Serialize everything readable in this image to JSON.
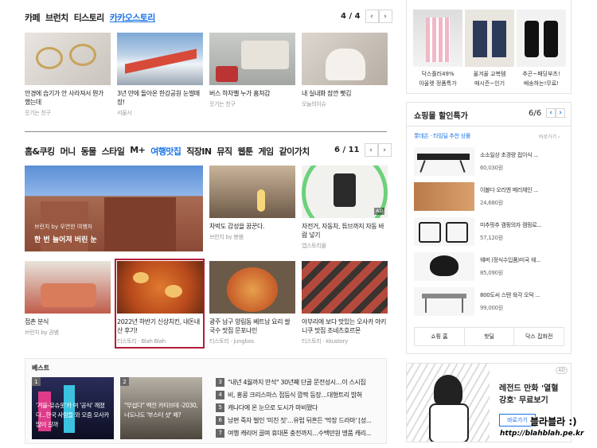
{
  "top": {
    "tabs": [
      "카페",
      "브런치",
      "티스토리",
      "카카오스토리"
    ],
    "page": "4 / 4",
    "cards": [
      {
        "caption": "안경에 습기가 안 사라져서 뭔가 했는데",
        "source": "웃기는 친구"
      },
      {
        "caption": "3년 만에 돌아온 한강공원 눈썰매장!",
        "source": "서울시"
      },
      {
        "caption": "버스 하차벨 누가 훔쳐감",
        "source": "웃기는 친구"
      },
      {
        "caption": "내 실내화 잠깐 빳김",
        "source": "오늘의이슈"
      }
    ]
  },
  "mid": {
    "tabs": [
      "홈&쿠킹",
      "머니",
      "동물",
      "스타일",
      "M+",
      "여행맛집",
      "직장IN",
      "뮤직",
      "웹툰",
      "게임",
      "같이가치"
    ],
    "page": "6 / 11",
    "hero": {
      "line1": "브런치 by 우연한 여행자",
      "line2": "한 번 늘어져 버린 눈"
    },
    "cards": [
      {
        "caption": "차박도 감성을 꿈꾼다.",
        "source": "브런치 by 봉쌤"
      },
      {
        "caption": "자전거, 자동차, 튜브까지 자동 바람 넣기",
        "source": "앱스토리몰",
        "badge": "AD"
      },
      {
        "caption": "접촌 분식",
        "source": "브런치 by 권쌤"
      },
      {
        "caption": "2022년 하반기 신상치킨, 내돈내산 후기!",
        "source": "티스토리 · Blah Blah"
      },
      {
        "caption": "광주 남구 양림동 베트남 요리 쌀국수 맛집 문포나인",
        "source": "티스토리 · jungbos"
      },
      {
        "caption": "아부리에 보다 맛있는 오사카 야키니쿠 맛집 조네츠호르몬",
        "source": "티스토리 · kkustory"
      }
    ]
  },
  "best": {
    "title": "베스트",
    "tiles": [
      {
        "rank": "1",
        "text": "'겨울-유슈옷'카 여 '공식' 깨졌다...한국 사람들 와 오즘 오사카많이 갈까"
      },
      {
        "rank": "2",
        "text": "\"무섭다\" 백전 카티브데 -2030, 너도나도 '부스터 샷' 왜?"
      }
    ],
    "list": [
      {
        "rank": "3",
        "text": "\"내년 4월까지 만석\" 30년째 단골 문전성시…이 스시집"
      },
      {
        "rank": "4",
        "text": "비, 홍콩 크리스마스 접등식 깜짝 등장…대형트리 밝혀"
      },
      {
        "rank": "5",
        "text": "캐나다에 온 눈으로 도시가 마비됐다"
      },
      {
        "rank": "6",
        "text": "남편 죽자 벌인 '미친 짓'…유럽 뒤흔든 '막장 드라마' [성..."
      },
      {
        "rank": "7",
        "text": "여행 캐리어 끌며 휴대폰 충전까지…수백만원 명품 캐리..."
      }
    ]
  },
  "right_top": {
    "items": [
      {
        "name": "닥스플러49%",
        "desc": "아울렛 정품특가"
      },
      {
        "name": "올겨울 교복템",
        "desc": "매시즌~인기"
      },
      {
        "name": "추곤~패딩부츠!",
        "desc": "배송하는!무료!"
      }
    ]
  },
  "shop": {
    "title": "쇼핑몰 할인특가",
    "page": "6/6",
    "subtitle": "롯데온 · 타임딜 추천 상품",
    "more": "바로가기 ›",
    "items": [
      {
        "name": "소소일상 초경량 접이식 ...",
        "price": "60,030원"
      },
      {
        "name": "이볼다 오리엔 메리체인 ...",
        "price": "24,680원"
      },
      {
        "name": "미추핏추 캠핑의자 캠핑로...",
        "price": "57,120원"
      },
      {
        "name": "웨버 (정식수입품)미국 웨...",
        "price": "85,090원"
      },
      {
        "name": "800도씨 스텐 육각 오덕 ...",
        "price": "99,000원"
      }
    ],
    "footer": [
      "쇼핑 홈",
      "핫딜",
      "닥스 집화전"
    ]
  },
  "ad": {
    "badge": "AD",
    "line1": "레전드 만화 '열혈",
    "line2": "강호' 무료보기",
    "button": "바로가기"
  },
  "watermark": {
    "title": "블라블라 :)",
    "url": "http://blahblah.pe.kr"
  }
}
